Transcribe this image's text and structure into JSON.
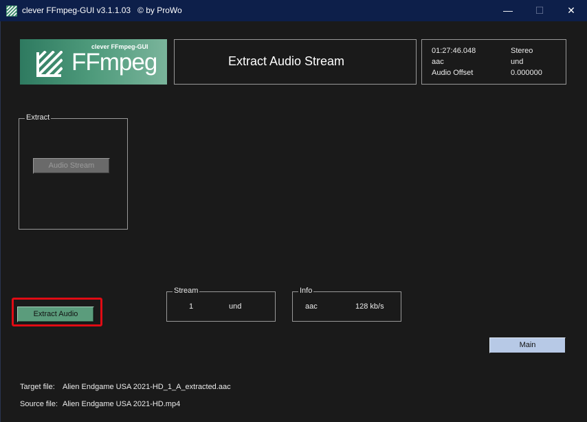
{
  "window": {
    "title": "clever FFmpeg-GUI v3.1.1.03   © by ProWo",
    "minimize": "—",
    "maximize": "☐",
    "close": "✕"
  },
  "logo": {
    "subtitle": "clever FFmpeg-GUI",
    "wordmark": "FFmpeg",
    "icon": "ffmpeg-logo-icon"
  },
  "header": {
    "title": "Extract Audio Stream"
  },
  "media_info": {
    "duration": "01:27:46.048",
    "channels": "Stereo",
    "codec": "aac",
    "language": "und",
    "audio_offset_label": "Audio Offset",
    "audio_offset_value": "0.000000"
  },
  "extract_group": {
    "legend": "Extract",
    "audio_stream_button": "Audio Stream"
  },
  "extract_audio_button": "Extract Audio",
  "stream_group": {
    "legend": "Stream",
    "index": "1",
    "language": "und"
  },
  "info_group": {
    "legend": "Info",
    "codec": "aac",
    "bitrate": "128 kb/s"
  },
  "main_button": "Main",
  "files": {
    "target_label": "Target file:",
    "target_value": "Alien Endgame USA 2021-HD_1_A_extracted.aac",
    "source_label": "Source file:",
    "source_value": "Alien Endgame USA 2021-HD.mp4"
  },
  "colors": {
    "titlebar": "#0d1f4a",
    "background": "#1a1a1a",
    "accent_green": "#5b9c7c",
    "main_button": "#b7c9e6",
    "highlight_red": "#e00b14"
  }
}
